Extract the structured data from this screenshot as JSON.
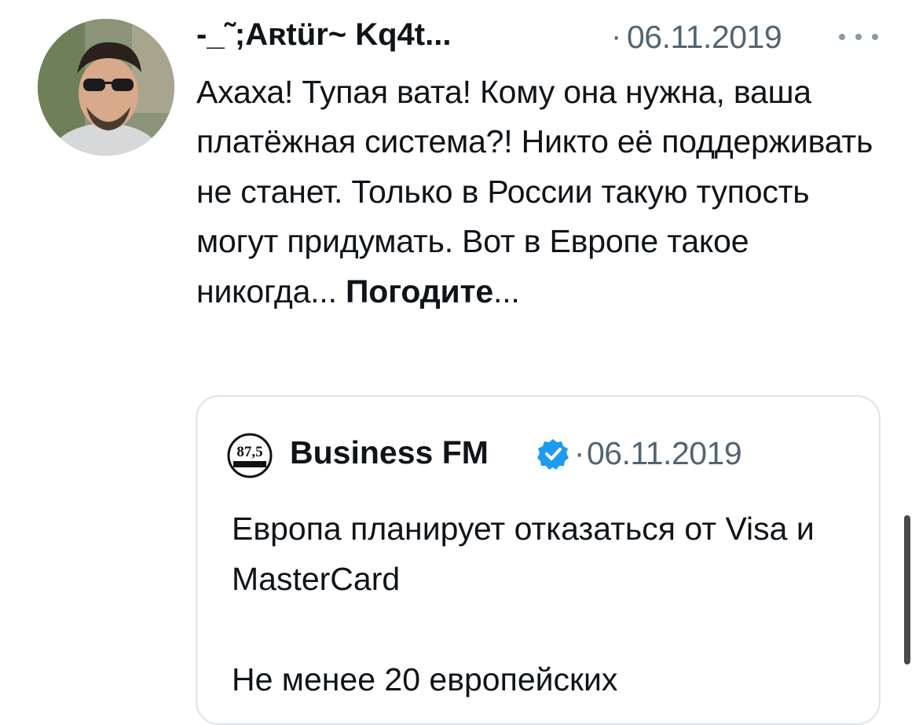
{
  "tweet": {
    "author_display_name": "-_˜;Aʀtür~ Kq4t...",
    "separator": "·",
    "date": "06.11.2019",
    "more_icon": "ellipsis-icon",
    "text_main": "Ахаха! Тупая вата! Кому она нужна, ваша платёжная система?! Никто её поддерживать не станет. Только в России такую тупость могут придумать. Вот в Европе такое никогда... ",
    "text_bold": "Погодите",
    "text_tail": "..."
  },
  "quoted_tweet": {
    "author_name": "Business FM",
    "verified_icon": "verified-badge-icon",
    "logo_text": "87,5",
    "separator": "·",
    "date": "06.11.2019",
    "text_line1": "Европа планирует отказаться от Visa и MasterCard",
    "text_line2": "Не менее 20 европейских"
  },
  "colors": {
    "text": "#0f1419",
    "secondary": "#536471",
    "border": "#dfe3e7",
    "verified": "#1d9bf0"
  }
}
